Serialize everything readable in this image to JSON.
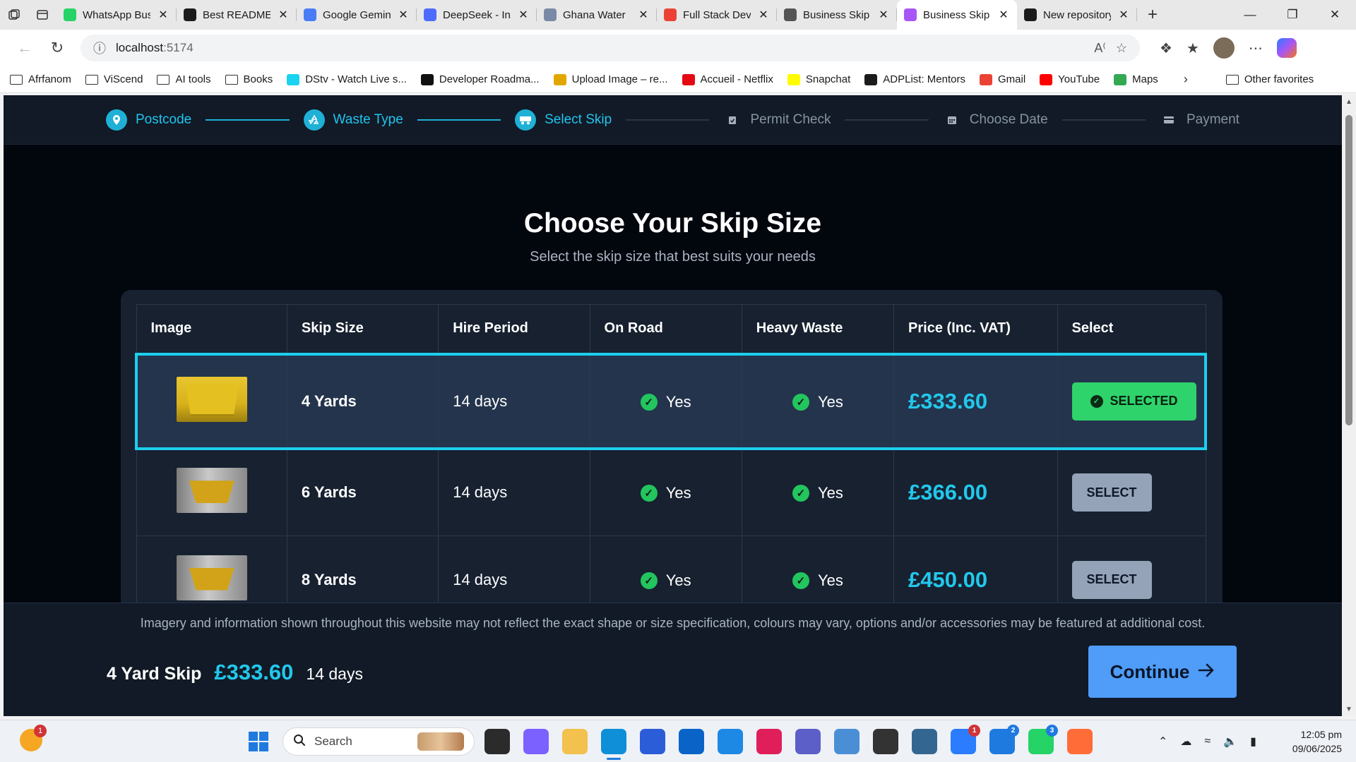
{
  "browser": {
    "tabs": [
      {
        "title": "WhatsApp Business",
        "icon": "whatsapp-icon",
        "color": "#25d366"
      },
      {
        "title": "Best README",
        "icon": "openai-icon",
        "color": "#1b1b1b"
      },
      {
        "title": "Google Gemini",
        "icon": "gemini-icon",
        "color": "#4a7cf6"
      },
      {
        "title": "DeepSeek - Into",
        "icon": "deepseek-icon",
        "color": "#4d6bfe"
      },
      {
        "title": "Ghana Water",
        "icon": "ghana-water-icon",
        "color": "#7a8aa6"
      },
      {
        "title": "Full Stack Dev",
        "icon": "gmail-icon",
        "color": "#ea4335"
      },
      {
        "title": "Business Skip",
        "icon": "globe-icon",
        "color": "#555555"
      },
      {
        "title": "Business Skip",
        "icon": "vite-icon",
        "color": "#a855f7",
        "active": true
      },
      {
        "title": "New repository",
        "icon": "github-icon",
        "color": "#1b1b1b"
      }
    ],
    "url": "localhost:5174",
    "url_host": "localhost",
    "url_port": ":5174",
    "bookmarks": [
      {
        "label": "Afrfanom",
        "icon": "folder-icon"
      },
      {
        "label": "ViScend",
        "icon": "folder-icon"
      },
      {
        "label": "AI tools",
        "icon": "folder-icon"
      },
      {
        "label": "Books",
        "icon": "folder-icon"
      },
      {
        "label": "DStv - Watch Live s...",
        "icon": "dstv-icon",
        "color": "#19d3f0"
      },
      {
        "label": "Developer Roadma...",
        "icon": "roadmap-icon",
        "color": "#111111"
      },
      {
        "label": "Upload Image – re...",
        "icon": "upload-icon",
        "color": "#e2a600"
      },
      {
        "label": "Accueil - Netflix",
        "icon": "netflix-icon",
        "color": "#e50914"
      },
      {
        "label": "Snapchat",
        "icon": "snapchat-icon",
        "color": "#fffc00"
      },
      {
        "label": "ADPList: Mentors",
        "icon": "adplist-icon",
        "color": "#1b1b1b"
      },
      {
        "label": "Gmail",
        "icon": "gmail-icon",
        "color": "#ea4335"
      },
      {
        "label": "YouTube",
        "icon": "youtube-icon",
        "color": "#ff0000"
      },
      {
        "label": "Maps",
        "icon": "maps-icon",
        "color": "#34a853"
      }
    ],
    "other_favorites": "Other favorites"
  },
  "stepper": {
    "steps": [
      {
        "label": "Postcode",
        "icon": "location-pin-icon",
        "state": "done"
      },
      {
        "label": "Waste Type",
        "icon": "recycle-icon",
        "state": "done"
      },
      {
        "label": "Select Skip",
        "icon": "truck-icon",
        "state": "current"
      },
      {
        "label": "Permit Check",
        "icon": "clipboard-icon",
        "state": "todo"
      },
      {
        "label": "Choose Date",
        "icon": "calendar-icon",
        "state": "todo"
      },
      {
        "label": "Payment",
        "icon": "credit-card-icon",
        "state": "todo"
      }
    ]
  },
  "page": {
    "title": "Choose Your Skip Size",
    "subtitle": "Select the skip size that best suits your needs"
  },
  "table": {
    "headers": [
      "Image",
      "Skip Size",
      "Hire Period",
      "On Road",
      "Heavy Waste",
      "Price (Inc. VAT)",
      "Select"
    ],
    "rows": [
      {
        "size": "4 Yards",
        "period": "14 days",
        "on_road": "Yes",
        "heavy_waste": "Yes",
        "price": "£333.60",
        "action": "SELECTED",
        "selected": true
      },
      {
        "size": "6 Yards",
        "period": "14 days",
        "on_road": "Yes",
        "heavy_waste": "Yes",
        "price": "£366.00",
        "action": "SELECT",
        "selected": false
      },
      {
        "size": "8 Yards",
        "period": "14 days",
        "on_road": "Yes",
        "heavy_waste": "Yes",
        "price": "£450.00",
        "action": "SELECT",
        "selected": false
      }
    ]
  },
  "footer": {
    "disclaimer": "Imagery and information shown throughout this website may not reflect the exact shape or size specification, colours may vary, options and/or accessories may be featured at additional cost.",
    "summary_name": "4 Yard Skip",
    "summary_price": "£333.60",
    "summary_period": "14 days",
    "continue_label": "Continue"
  },
  "taskbar": {
    "search_placeholder": "Search",
    "weather_badge": "1",
    "apps": [
      {
        "icon": "task-view-icon",
        "color": "#2b2b2b"
      },
      {
        "icon": "copilot-m365-icon",
        "color": "#7b61ff"
      },
      {
        "icon": "file-explorer-icon",
        "color": "#f2c14e"
      },
      {
        "icon": "edge-icon",
        "color": "#0f8fd8",
        "active": true
      },
      {
        "icon": "microsoft-store-icon",
        "color": "#2b5dd8"
      },
      {
        "icon": "outlook-icon",
        "color": "#0a64c8"
      },
      {
        "icon": "vscode-icon",
        "color": "#1e88e5"
      },
      {
        "icon": "slack-icon",
        "color": "#e01e5a"
      },
      {
        "icon": "teams-icon",
        "color": "#5b5fc7"
      },
      {
        "icon": "onedrive-icon",
        "color": "#4a8fd6"
      },
      {
        "icon": "soccer-app-icon",
        "color": "#333333"
      },
      {
        "icon": "postgresql-icon",
        "color": "#336791"
      },
      {
        "icon": "messenger-icon",
        "color": "#2b7cff",
        "badge": "1",
        "badge_color": "#d13438"
      },
      {
        "icon": "chat-app-icon",
        "color": "#1f7ae0",
        "badge": "2",
        "badge_color": "#1f7ae0"
      },
      {
        "icon": "whatsapp-icon",
        "color": "#25d366",
        "badge": "3",
        "badge_color": "#1f7ae0"
      },
      {
        "icon": "postman-icon",
        "color": "#ff6c37"
      }
    ],
    "time": "12:05 pm",
    "date": "09/06/2025"
  },
  "colors": {
    "accent_cyan": "#22c8ec",
    "selected_green": "#2fd36b",
    "continue_blue": "#4f9cf9",
    "page_bg": "#02060d"
  }
}
